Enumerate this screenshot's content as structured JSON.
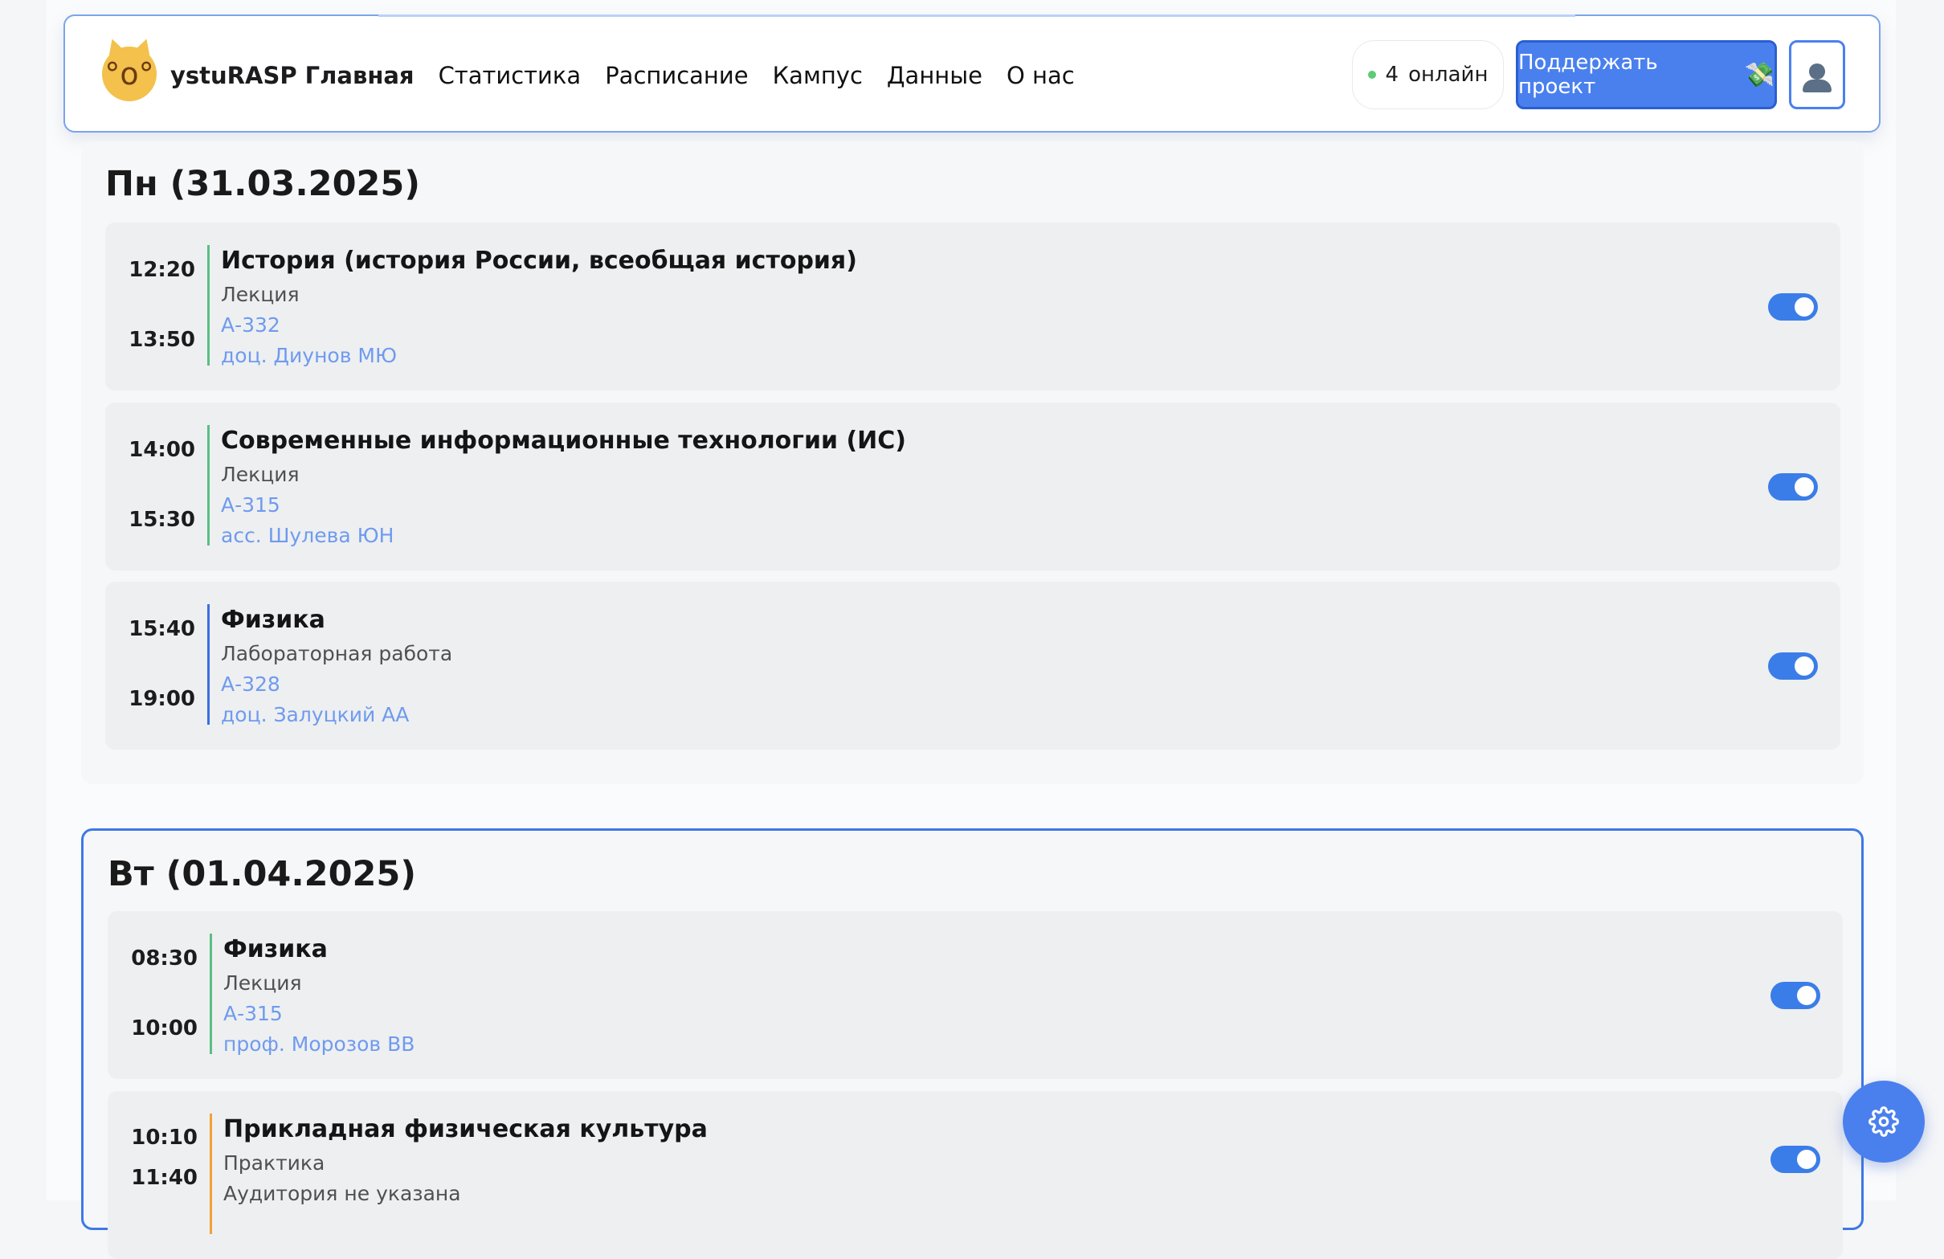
{
  "header": {
    "brand": "ystuRASP Главная",
    "nav": [
      "Статистика",
      "Расписание",
      "Кампус",
      "Данные",
      "О нас"
    ],
    "online_count": "4",
    "online_label": "онлайн",
    "support_label": "Поддержать проект",
    "support_icon": "money-icon",
    "profile_icon": "user-icon",
    "accent": "#4a80ee"
  },
  "days": [
    {
      "title": "Пн (31.03.2025)",
      "lessons": [
        {
          "start": "12:20",
          "end": "13:50",
          "subject": "История (история России, всеобщая история)",
          "kind": "Лекция",
          "room": "А-332",
          "teacher": "доц. Диунов МЮ",
          "bar_color": "#58c083",
          "enabled": true
        },
        {
          "start": "14:00",
          "end": "15:30",
          "subject": "Современные информационные технологии (ИС)",
          "kind": "Лекция",
          "room": "А-315",
          "teacher": "асс. Шулева ЮН",
          "bar_color": "#58c083",
          "enabled": true
        },
        {
          "start": "15:40",
          "end": "19:00",
          "subject": "Физика",
          "kind": "Лабораторная работа",
          "room": "А-328",
          "teacher": "доц. Залуцкий АА",
          "bar_color": "#3a6fe0",
          "enabled": true
        }
      ]
    },
    {
      "title": "Вт (01.04.2025)",
      "lessons": [
        {
          "start": "08:30",
          "end": "10:00",
          "subject": "Физика",
          "kind": "Лекция",
          "room": "А-315",
          "teacher": "проф. Морозов ВВ",
          "bar_color": "#58c083",
          "enabled": true
        },
        {
          "start": "10:10",
          "end": "11:40",
          "subject": "Прикладная физическая культура",
          "kind": "Практика",
          "room": "Аудитория не указана",
          "teacher": "",
          "bar_color": "#f0a23a",
          "enabled": true
        }
      ]
    }
  ],
  "settings_icon": "gear-icon"
}
